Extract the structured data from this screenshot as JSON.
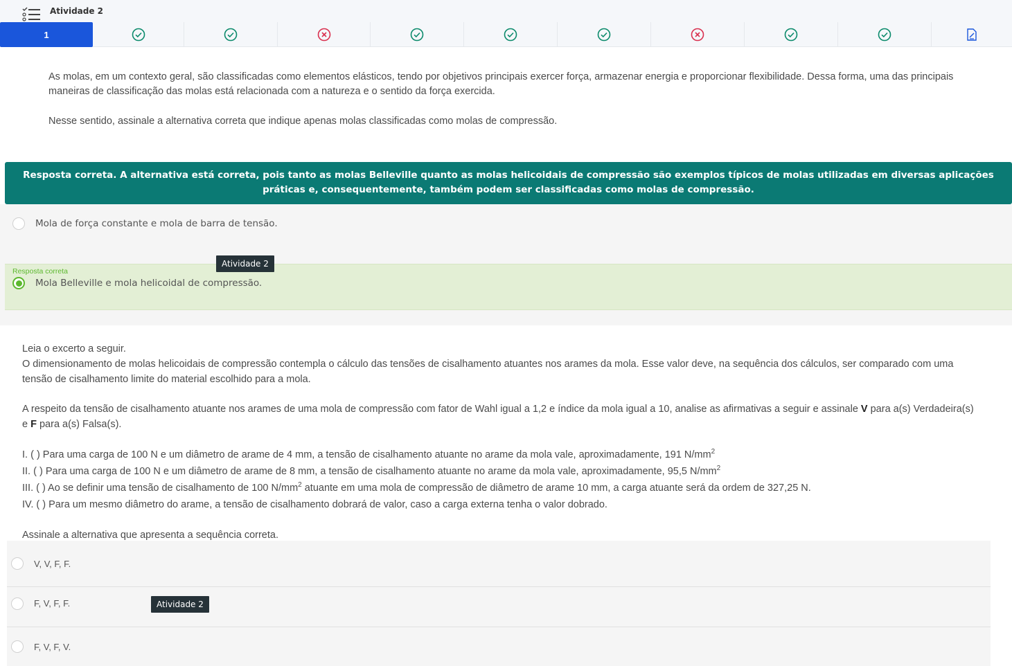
{
  "header": {
    "title": "Atividade 2",
    "menu_icon": "list-menu-icon"
  },
  "question_nav": {
    "items": [
      {
        "label": "1",
        "status": "current"
      },
      {
        "status": "correct"
      },
      {
        "status": "correct"
      },
      {
        "status": "incorrect"
      },
      {
        "status": "correct"
      },
      {
        "status": "correct"
      },
      {
        "status": "correct"
      },
      {
        "status": "incorrect"
      },
      {
        "status": "correct"
      },
      {
        "status": "correct"
      },
      {
        "status": "submit"
      }
    ],
    "colors": {
      "active": "#1a56db",
      "correct": "#0b8a6b",
      "incorrect": "#d9304f",
      "submit": "#1a56db"
    }
  },
  "question1": {
    "paragraph1": "As molas, em um contexto geral, são classificadas como elementos elásticos, tendo por objetivos principais exercer força, armazenar energia e proporcionar flexibilidade. Dessa forma, uma das principais maneiras de classificação das molas está relacionada com a natureza e o sentido da força exercida.",
    "paragraph2": "Nesse sentido, assinale a alternativa correta que indique apenas molas classificadas como molas de compressão.",
    "feedback": "Resposta correta. A alternativa está correta, pois tanto as molas Belleville quanto as molas helicoidais de compressão são exemplos típicos de molas utilizadas em diversas aplicações práticas e, consequentemente, também podem ser classificadas como molas de compressão.",
    "feedback_color": "#0b7a74",
    "options": [
      {
        "text": "Mola de força constante e mola de barra de tensão.",
        "selected": false
      },
      {
        "text": "Mola Belleville e mola helicoidal de compressão.",
        "selected": true
      }
    ],
    "correct_label": "Resposta correta",
    "tooltip": "Atividade 2"
  },
  "question2": {
    "intro": "Leia o excerto a seguir.",
    "excerpt": "O dimensionamento de molas helicoidais de compressão contempla o cálculo das tensões de cisalhamento atuantes nos arames da mola. Esse valor deve, na sequência dos cálculos, ser comparado com uma tensão de cisalhamento limite do material escolhido para a mola.",
    "prompt_part1": "A respeito da tensão de cisalhamento atuante nos arames de uma mola de compressão com fator de Wahl igual a 1,2 e índice da mola igual a 10, analise as afirmativas a seguir e assinale ",
    "prompt_v": "V",
    "prompt_part2": " para a(s) Verdadeira(s) e ",
    "prompt_f": "F",
    "prompt_part3": " para a(s) Falsa(s).",
    "s1": "I. ( ) Para uma carga de 100 N e um diâmetro de arame de 4 mm, a tensão de cisalhamento atuante no arame da mola vale, aproximadamente, 191 N/mm",
    "s2": "II. ( ) Para uma carga de 100 N e um diâmetro de arame de 8 mm, a tensão de cisalhamento atuante no arame da mola vale, aproximadamente, 95,5 N/mm",
    "s3a": "III. ( ) Ao se definir uma tensão de cisalhamento de 100 N/mm",
    "s3b": " atuante em uma mola de compressão de diâmetro de arame 10 mm, a carga atuante será da ordem de 327,25 N.",
    "s4": "IV. ( ) Para um mesmo diâmetro do arame, a tensão de cisalhamento dobrará de valor, caso a carga externa tenha o valor dobrado.",
    "sup": "2",
    "final_prompt": "Assinale a alternativa que apresenta a sequência correta.",
    "options": [
      "V, V, F, F.",
      "F, V, F, F.",
      "F, V, F, V."
    ],
    "tooltip": "Atividade 2"
  }
}
